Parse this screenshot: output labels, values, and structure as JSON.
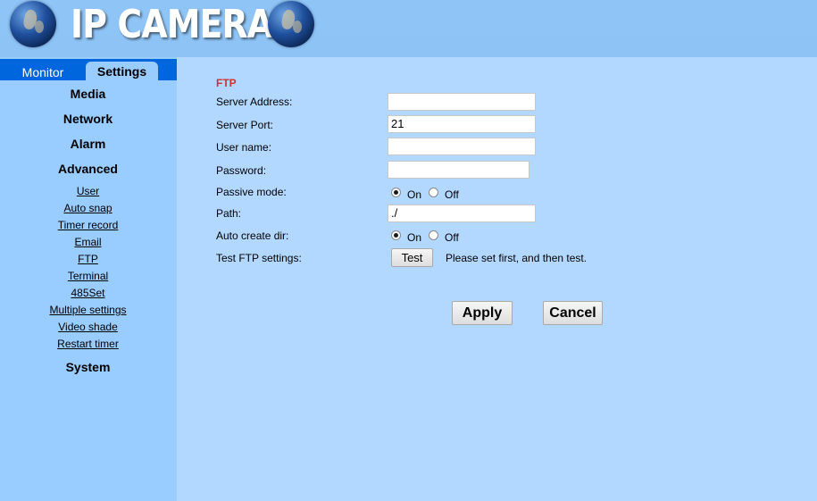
{
  "header": {
    "title": "IP CAMERA"
  },
  "tabs": {
    "monitor": "Monitor",
    "settings": "Settings"
  },
  "sidebar": {
    "sections": {
      "media": "Media",
      "network": "Network",
      "alarm": "Alarm",
      "advanced": "Advanced",
      "system": "System"
    },
    "advanced_items": [
      "User",
      "Auto snap",
      "Timer record",
      "Email",
      "FTP",
      "Terminal",
      "485Set",
      "Multiple settings",
      "Video shade",
      "Restart timer"
    ]
  },
  "ftp": {
    "section_title": "FTP",
    "server_address": {
      "label": "Server Address:",
      "value": ""
    },
    "server_port": {
      "label": "Server Port:",
      "value": "21"
    },
    "user_name": {
      "label": "User name:",
      "value": ""
    },
    "password": {
      "label": "Password:",
      "value": ""
    },
    "passive_mode": {
      "label": "Passive mode:",
      "selected": "On",
      "on_label": "On",
      "off_label": "Off"
    },
    "path": {
      "label": "Path:",
      "value": "./"
    },
    "auto_create_dir": {
      "label": "Auto create dir:",
      "selected": "On",
      "on_label": "On",
      "off_label": "Off"
    },
    "test": {
      "label": "Test FTP settings:",
      "button": "Test",
      "hint": "Please set first, and then test."
    }
  },
  "actions": {
    "apply": "Apply",
    "cancel": "Cancel"
  },
  "colors": {
    "section_title": "#cc3333",
    "tab_bar": "#0066dd",
    "sidebar_bg": "#99ccff",
    "content_bg": "#b3d8ff"
  }
}
